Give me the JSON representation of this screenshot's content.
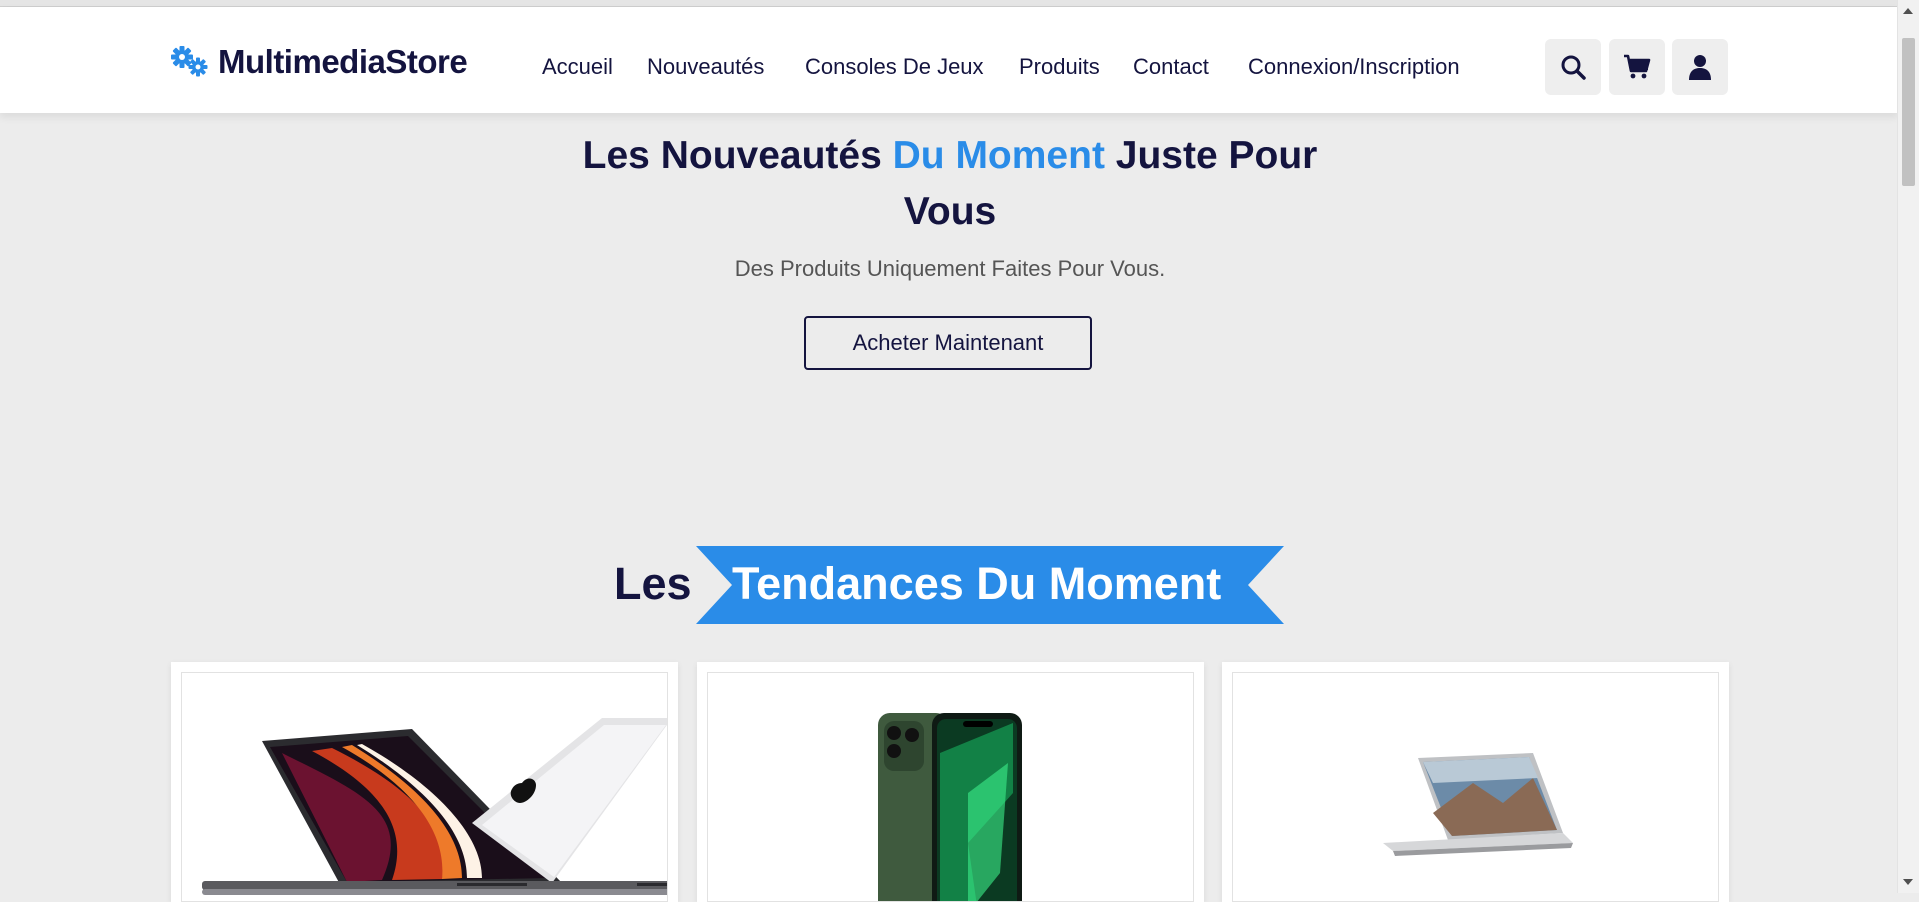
{
  "brand": {
    "name": "MultimediaStore",
    "logo_icon": "gears-icon",
    "accent_color": "#2a8ce8",
    "dark_color": "#14143f"
  },
  "nav": {
    "items": [
      {
        "label": "Accueil"
      },
      {
        "label": "Nouveautés"
      },
      {
        "label": "Consoles De Jeux"
      },
      {
        "label": "Produits"
      },
      {
        "label": "Contact"
      },
      {
        "label": "Connexion/Inscription"
      }
    ],
    "actions": [
      {
        "icon": "search-icon"
      },
      {
        "icon": "cart-icon"
      },
      {
        "icon": "user-icon"
      }
    ]
  },
  "hero": {
    "title_part1": "Les Nouveautés ",
    "title_accent": "Du Moment",
    "title_part2": " Juste Pour Vous",
    "subtitle": "Des Produits Uniquement Faites Pour Vous.",
    "cta_label": "Acheter Maintenant"
  },
  "trending": {
    "title_prefix": "Les",
    "title_highlight": "Tendances Du Moment",
    "products": [
      {
        "image": "macbook-pro-image"
      },
      {
        "image": "iphone-13-pro-green-image"
      },
      {
        "image": "surface-book-image"
      }
    ]
  }
}
